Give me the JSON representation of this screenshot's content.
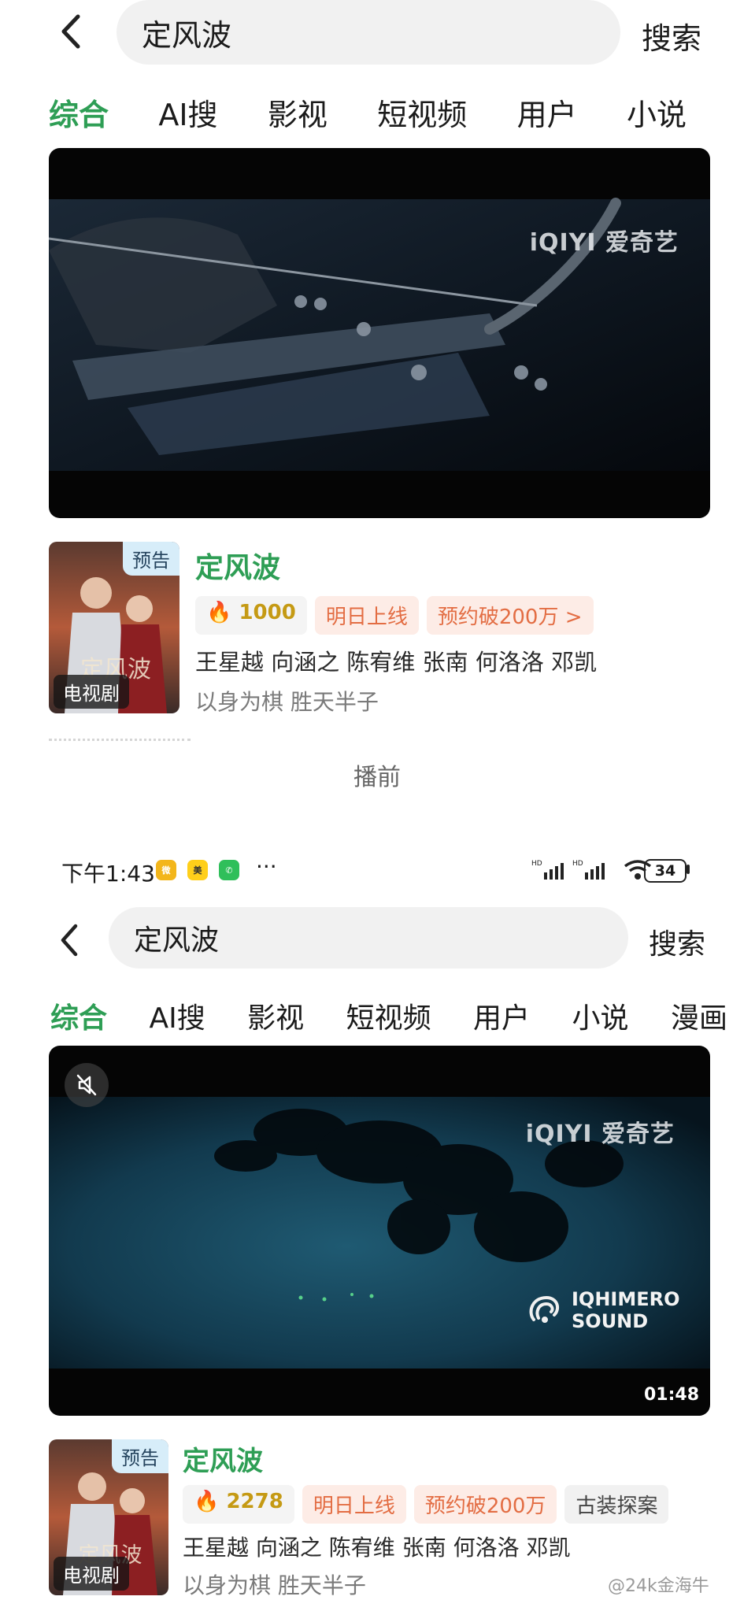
{
  "shot1": {
    "search": {
      "query": "定风波",
      "button": "搜索"
    },
    "tabs": [
      "综合",
      "AI搜",
      "影视",
      "短视频",
      "用户",
      "小说"
    ],
    "player": {
      "brand": "iQIYI 爱奇艺"
    },
    "result": {
      "badge": "预告",
      "type": "电视剧",
      "title": "定风波",
      "heat": "1000",
      "chip_online": "明日上线",
      "chip_reserve": "预约破200万 >",
      "cast": "王星越  向涵之  陈宥维  张南  何洛洛  邓凯",
      "tagline": "以身为棋 胜天半子"
    },
    "caption": "播前"
  },
  "status_bar": {
    "time": "下午1:43",
    "dots": "···",
    "battery": "34"
  },
  "shot2": {
    "search": {
      "query": "定风波",
      "button": "搜索"
    },
    "tabs": [
      "综合",
      "AI搜",
      "影视",
      "短视频",
      "用户",
      "小说",
      "漫画"
    ],
    "player": {
      "brand": "iQIYI 爱奇艺",
      "sound_line1": "IQHIMERO",
      "sound_line2": "SOUND",
      "duration": "01:48"
    },
    "result": {
      "badge": "预告",
      "type": "电视剧",
      "title": "定风波",
      "heat": "2278",
      "chip_online": "明日上线",
      "chip_reserve": "预约破200万",
      "chip_genre": "古装探案",
      "cast": "王星越  向涵之  陈宥维  张南  何洛洛  邓凯",
      "tagline": "以身为棋 胜天半子"
    }
  },
  "watermark": "@24k金海牛",
  "colors": {
    "accent_green": "#2e9e55",
    "chip_orange": "#e36d43",
    "heat_gold": "#c59a14"
  }
}
